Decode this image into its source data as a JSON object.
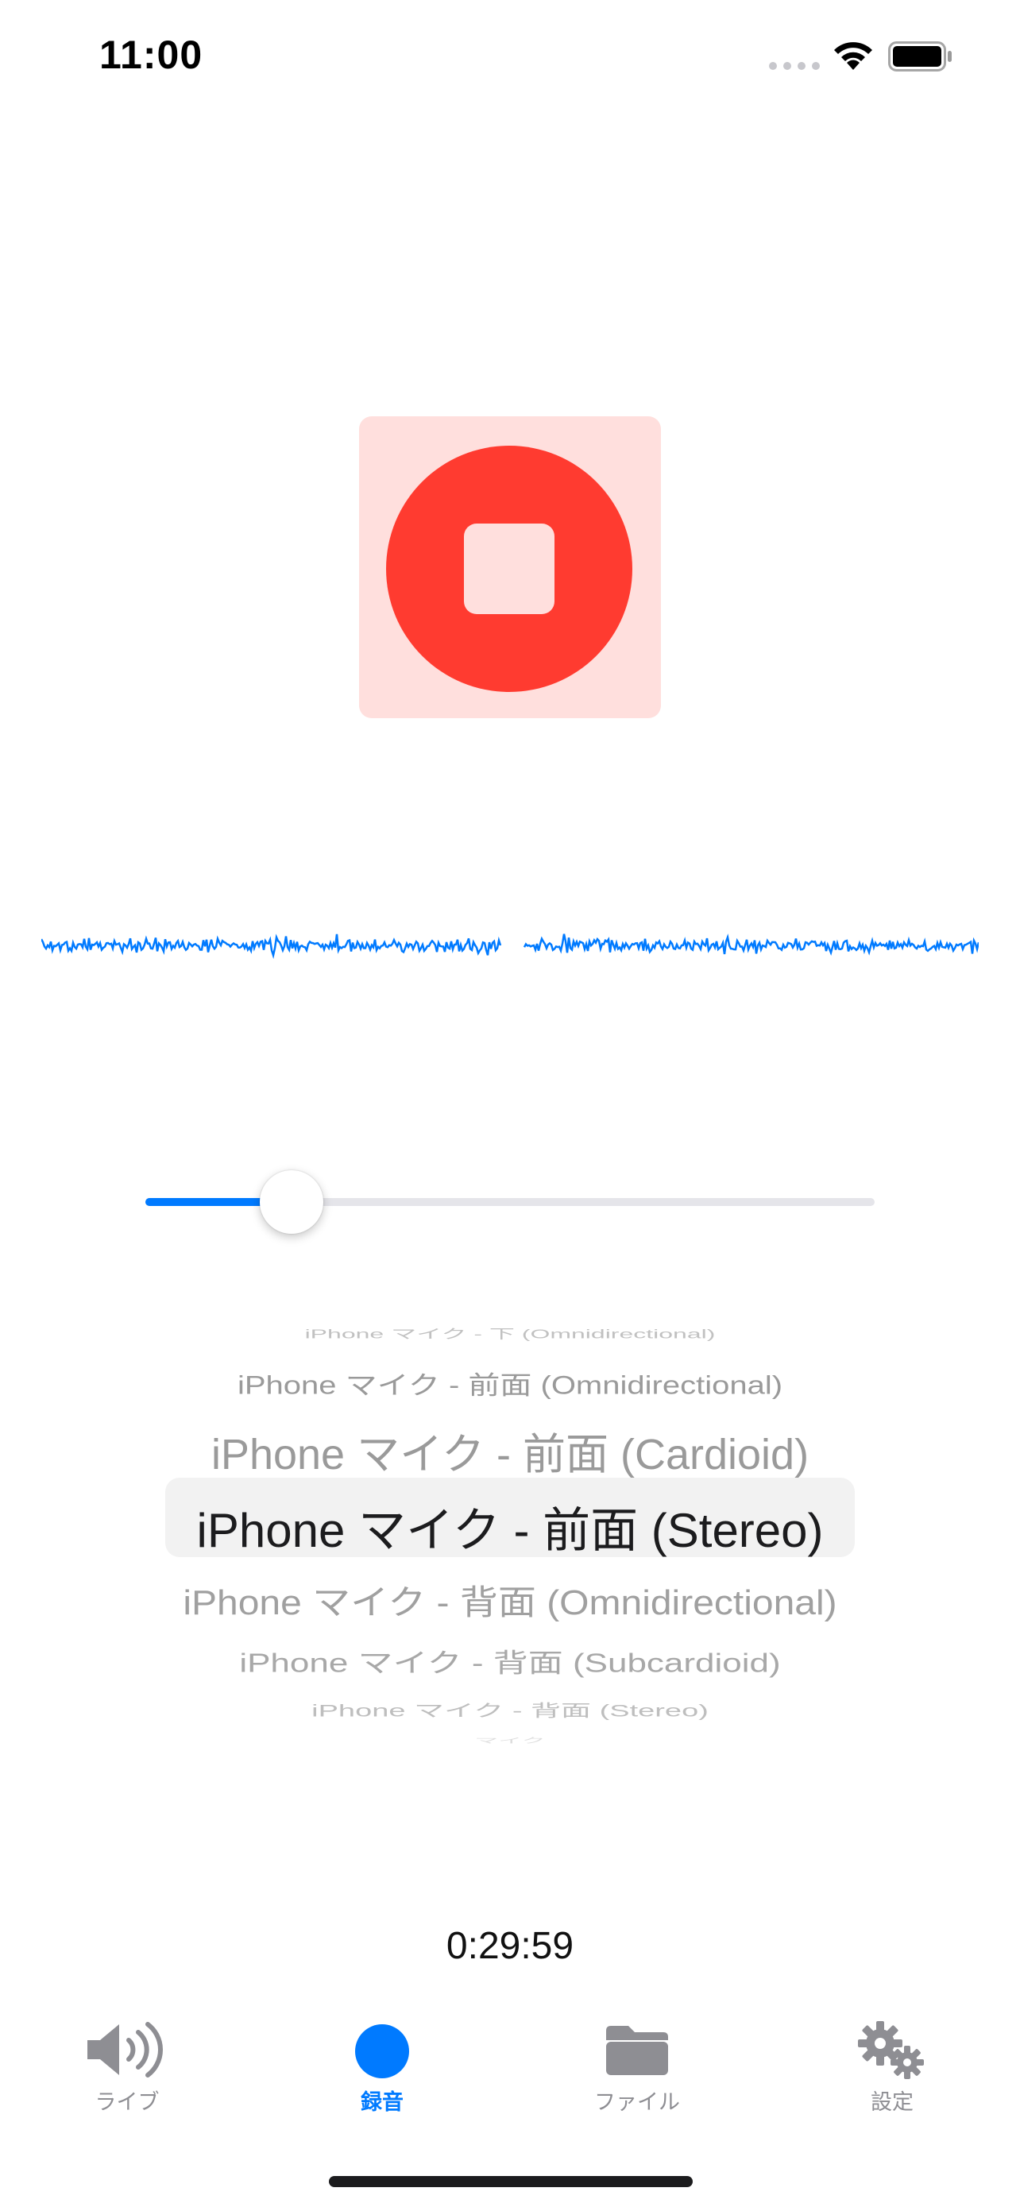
{
  "status_bar": {
    "time": "11:00"
  },
  "recorder": {
    "state": "recording",
    "elapsed": "0:29:59",
    "gain_level": 0.2
  },
  "mic_picker": {
    "items": [
      "iPhone マイク - 下 (Omnidirectional)",
      "iPhone マイク - 前面 (Omnidirectional)",
      "iPhone マイク - 前面 (Cardioid)",
      "iPhone マイク - 前面 (Stereo)",
      "iPhone マイク - 背面 (Omnidirectional)",
      "iPhone マイク - 背面 (Subcardioid)",
      "iPhone マイク - 背面 (Stereo)",
      "マイク"
    ],
    "selected_index": 3
  },
  "tabs": [
    {
      "label": "ライブ",
      "icon": "speaker-icon",
      "active": false
    },
    {
      "label": "録音",
      "icon": "record-dot-icon",
      "active": true
    },
    {
      "label": "ファイル",
      "icon": "folder-icon",
      "active": false
    },
    {
      "label": "設定",
      "icon": "gears-icon",
      "active": false
    }
  ],
  "colors": {
    "accent": "#007aff",
    "record_red": "#ff3b30",
    "record_bg": "#ffdfdd",
    "inactive": "#8e8e93"
  }
}
